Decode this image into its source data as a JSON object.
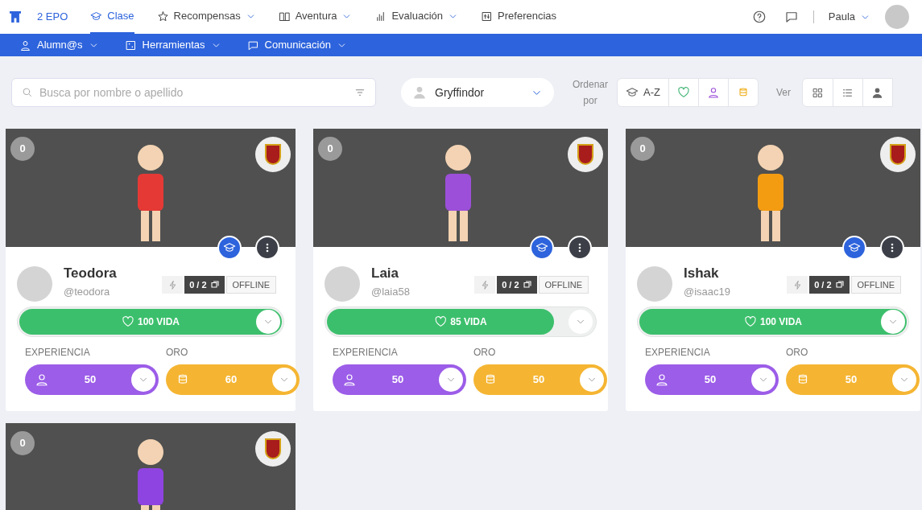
{
  "top_nav": {
    "class_name": "2 EPO",
    "items": [
      {
        "label": "Clase",
        "kind": "cap",
        "selected": true,
        "dropdown": false
      },
      {
        "label": "Recompensas",
        "kind": "star",
        "selected": false,
        "dropdown": true
      },
      {
        "label": "Aventura",
        "kind": "book",
        "selected": false,
        "dropdown": true
      },
      {
        "label": "Evaluación",
        "kind": "bars",
        "selected": false,
        "dropdown": true
      },
      {
        "label": "Preferencias",
        "kind": "sliders",
        "selected": false,
        "dropdown": false
      }
    ],
    "user": "Paula"
  },
  "sub_nav": [
    {
      "label": "Alumn@s",
      "kind": "person"
    },
    {
      "label": "Herramientas",
      "kind": "dice"
    },
    {
      "label": "Comunicación",
      "kind": "chat"
    }
  ],
  "toolbar": {
    "search_placeholder": "Busca por nombre o apellido",
    "group": "Gryffindor",
    "sort_label": "Ordenar por",
    "sort_options": [
      {
        "kind": "cap",
        "label": "A-Z"
      },
      {
        "kind": "heart"
      },
      {
        "kind": "person"
      },
      {
        "kind": "coins"
      }
    ],
    "view_label": "Ver",
    "view_options": [
      {
        "kind": "grid"
      },
      {
        "kind": "list"
      },
      {
        "kind": "people"
      }
    ]
  },
  "students": [
    {
      "points": "0",
      "color": "#e53935",
      "name": "Teodora",
      "username": "@teodora",
      "cards": "0 / 2",
      "status": "OFFLINE",
      "life": "100 VIDA",
      "level": 1,
      "xp_label": "EXPERIENCIA",
      "xp": "50",
      "gold_label": "ORO",
      "gold": "60"
    },
    {
      "points": "0",
      "color": "#9c4fd8",
      "name": "Laia",
      "username": "@laia58",
      "cards": "0 / 2",
      "status": "OFFLINE",
      "life": "85 VIDA",
      "level": 0.85,
      "xp_label": "EXPERIENCIA",
      "xp": "50",
      "gold_label": "ORO",
      "gold": "50"
    },
    {
      "points": "0",
      "color": "#f39c12",
      "name": "Ishak",
      "username": "@isaac19",
      "cards": "0 / 2",
      "status": "OFFLINE",
      "life": "100 VIDA",
      "level": 1,
      "xp_label": "EXPERIENCIA",
      "xp": "50",
      "gold_label": "ORO",
      "gold": "50"
    },
    {
      "points": "0",
      "color": "#8e44e0"
    }
  ]
}
